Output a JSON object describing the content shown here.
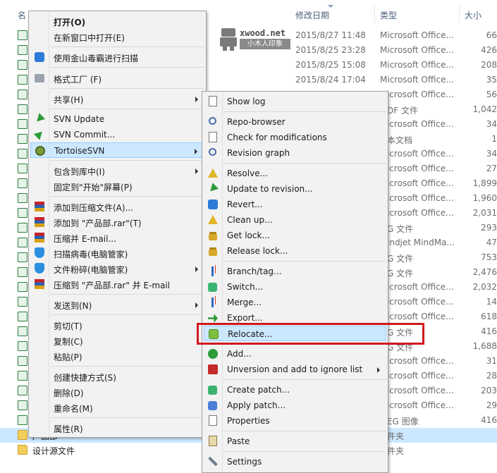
{
  "explorer": {
    "columns": {
      "name": "名",
      "modified": "修改日期",
      "type": "类型",
      "size": "大小"
    },
    "watermark": {
      "brand": "xwood.net",
      "sub": "小木人印象"
    },
    "rows": [
      {
        "date": "2015/8/27 11:48",
        "type": "Microsoft Office...",
        "size": "66"
      },
      {
        "date": "2015/8/25 23:28",
        "type": "Microsoft Office...",
        "size": "426"
      },
      {
        "date": "2015/8/25 15:08",
        "type": "Microsoft Office...",
        "size": "208"
      },
      {
        "date": "2015/8/24 17:04",
        "type": "Microsoft Office...",
        "size": "35"
      },
      {
        "date": "",
        "type": "icrosoft Office...",
        "size": "56"
      },
      {
        "date": "",
        "type": "DF 文件",
        "size": "1,042"
      },
      {
        "date": "",
        "type": "icrosoft Office...",
        "size": "34"
      },
      {
        "date": "",
        "type": "本文档",
        "size": "1"
      },
      {
        "date": "",
        "type": "icrosoft Office...",
        "size": "34"
      },
      {
        "date": "",
        "type": "icrosoft Office...",
        "size": "27"
      },
      {
        "date": "",
        "type": "icrosoft Office...",
        "size": "1,899"
      },
      {
        "date": "",
        "type": "icrosoft Office...",
        "size": "1,960"
      },
      {
        "date": "",
        "type": "icrosoft Office...",
        "size": "2,031"
      },
      {
        "date": "",
        "type": "G 文件",
        "size": "293"
      },
      {
        "date": "",
        "type": "indjet MindMa...",
        "size": "47"
      },
      {
        "date": "",
        "type": "G 文件",
        "size": "753"
      },
      {
        "date": "",
        "type": "G 文件",
        "size": "2,476"
      },
      {
        "date": "",
        "type": "icrosoft Office...",
        "size": "2,032"
      },
      {
        "date": "",
        "type": "icrosoft Office...",
        "size": "14"
      },
      {
        "date": "",
        "type": "icrosoft Office...",
        "size": "618"
      },
      {
        "date": "",
        "type": "G 文件",
        "size": "416"
      },
      {
        "date": "",
        "type": "G 文件",
        "size": "1,688"
      },
      {
        "date": "",
        "type": "icrosoft Office...",
        "size": "31"
      },
      {
        "date": "",
        "type": "icrosoft Office...",
        "size": "28"
      },
      {
        "date": "",
        "type": "icrosoft Office...",
        "size": "203"
      },
      {
        "date": "",
        "type": "icrosoft Office...",
        "size": "29"
      },
      {
        "date": "",
        "type": "EG 图像",
        "size": "416"
      },
      {
        "date": "",
        "type": "件夹",
        "size": ""
      },
      {
        "date": "",
        "type": "件夹",
        "size": ""
      }
    ],
    "selected_file": "产品部",
    "folder_name": "设计源文件"
  },
  "menu1": {
    "items": {
      "open": "打开(O)",
      "open_new": "在新窗口中打开(E)",
      "scan": "使用金山毒霸进行扫描",
      "format_factory": "格式工厂 (F)",
      "share": "共享(H)",
      "svn_update": "SVN Update",
      "svn_commit": "SVN Commit...",
      "tortoise": "TortoiseSVN",
      "include_lib": "包含到库中(I)",
      "pin_start": "固定到\"开始\"屏幕(P)",
      "add_archive": "添加到压缩文件(A)...",
      "add_rar": "添加到 \"产品部.rar\"(T)",
      "compress_email": "压缩并 E-mail...",
      "virus_scan": "扫描病毒(电脑管家)",
      "shred": "文件粉碎(电脑管家)",
      "compress_rar_email": "压缩到 \"产品部.rar\" 并 E-mail",
      "send_to": "发送到(N)",
      "cut": "剪切(T)",
      "copy": "复制(C)",
      "paste": "粘贴(P)",
      "create_shortcut": "创建快捷方式(S)",
      "delete": "删除(D)",
      "rename": "重命名(M)",
      "properties": "属性(R)"
    }
  },
  "menu2": {
    "items": {
      "show_log": "Show log",
      "repo_browser": "Repo-browser",
      "check_mods": "Check for modifications",
      "rev_graph": "Revision graph",
      "resolve": "Resolve...",
      "update_rev": "Update to revision...",
      "revert": "Revert...",
      "cleanup": "Clean up...",
      "get_lock": "Get lock...",
      "release_lock": "Release lock...",
      "branch_tag": "Branch/tag...",
      "switch": "Switch...",
      "merge": "Merge...",
      "export": "Export...",
      "relocate": "Relocate...",
      "add": "Add...",
      "unversion": "Unversion and add to ignore list",
      "create_patch": "Create patch...",
      "apply_patch": "Apply patch...",
      "properties": "Properties",
      "paste": "Paste",
      "settings": "Settings"
    }
  }
}
